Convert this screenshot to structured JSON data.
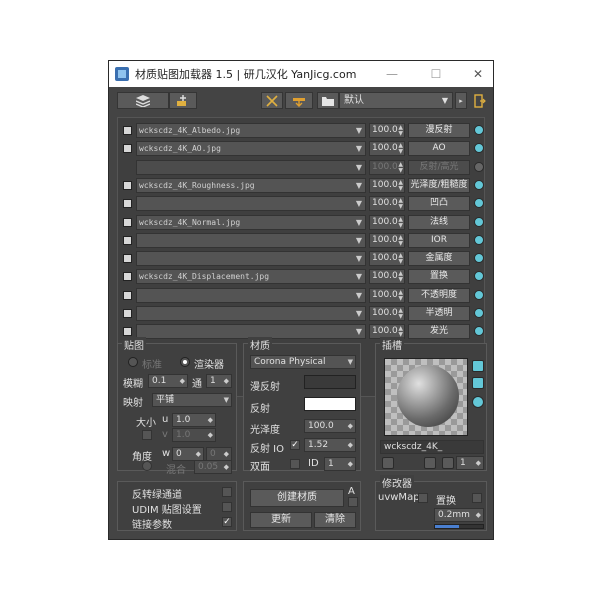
{
  "window": {
    "title": "材质贴图加载器 1.5 | 研几汉化 YanJicg.com",
    "minimize": "—",
    "maximize": "☐",
    "close": "✕"
  },
  "toolbar": {
    "preset_value": "默认",
    "buttons": [
      "layers-icon",
      "add-map-icon",
      "scissors-icon",
      "folder-up-icon",
      "folder-icon",
      "exit-icon"
    ],
    "small_btn": "▸"
  },
  "map_rows": [
    {
      "file": "wckscdz_4K_Albedo.jpg",
      "amount": "100.0",
      "slot": "漫反射",
      "enabled": true
    },
    {
      "file": "wckscdz_4K_AO.jpg",
      "amount": "100.0",
      "slot": "AO",
      "enabled": true
    },
    {
      "file": "",
      "amount": "100.0",
      "slot": "反射/高光",
      "enabled": false
    },
    {
      "file": "wckscdz_4K_Roughness.jpg",
      "amount": "100.0",
      "slot": "光泽度/粗糙度",
      "enabled": true
    },
    {
      "file": "",
      "amount": "100.0",
      "slot": "凹凸",
      "enabled": true
    },
    {
      "file": "wckscdz_4K_Normal.jpg",
      "amount": "100.0",
      "slot": "法线",
      "enabled": true
    },
    {
      "file": "",
      "amount": "100.0",
      "slot": "IOR",
      "enabled": true
    },
    {
      "file": "",
      "amount": "100.0",
      "slot": "金属度",
      "enabled": true
    },
    {
      "file": "wckscdz_4K_Displacement.jpg",
      "amount": "100.0",
      "slot": "置换",
      "enabled": true
    },
    {
      "file": "",
      "amount": "100.0",
      "slot": "不透明度",
      "enabled": true
    },
    {
      "file": "",
      "amount": "100.0",
      "slot": "半透明",
      "enabled": true
    },
    {
      "file": "",
      "amount": "100.0",
      "slot": "发光",
      "enabled": true
    }
  ],
  "mapping": {
    "title": "贴图",
    "standard": "标准",
    "renderer": "渲染器",
    "blur_label": "模糊",
    "blur_value": "0.1",
    "pass_label": "通",
    "pass_value": "1",
    "mapping_label": "映射",
    "mapping_value": "平铺",
    "size_label": "大小",
    "u_label": "u",
    "u_value": "1.0",
    "v_label": "v",
    "v_value": "1.0",
    "angle_label": "角度",
    "w_label": "w",
    "w_value": "0",
    "angle2_value": "0",
    "blend_label": "混合",
    "blend_value": "0.05"
  },
  "material": {
    "title": "材质",
    "type_value": "Corona Physical",
    "diffuse_label": "漫反射",
    "diffuse_color": "#3a3a3a",
    "reflect_label": "反射",
    "reflect_color": "#ffffff",
    "gloss_label": "光泽度",
    "gloss_value": "100.0",
    "reflect_io_label": "反射 IO",
    "ior_value": "1.52",
    "double_label": "双面",
    "id_label": "ID",
    "id_value": "1"
  },
  "slot": {
    "title": "插槽",
    "name_value": "wckscdz_4K_",
    "count_value": "1"
  },
  "options": {
    "flip_green": "反转绿通道",
    "udim": "UDIM 贴图设置",
    "link_params": "链接参数"
  },
  "actions": {
    "create": "创建材质",
    "a_label": "A",
    "update": "更新",
    "clear": "清除"
  },
  "modifier": {
    "title": "修改器",
    "uvw_label": "uvwMap",
    "disp_label": "置换",
    "disp_value": "0.2mm"
  },
  "colors": {
    "accent": "#63c7d7",
    "panel_bg": "#444444"
  }
}
